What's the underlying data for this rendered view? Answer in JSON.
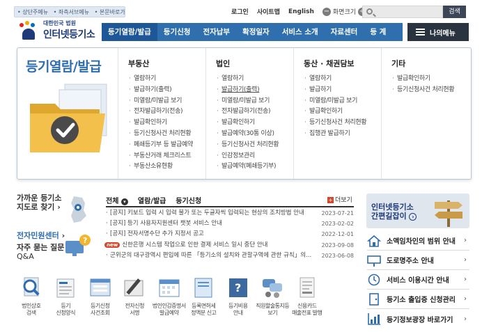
{
  "skip_links": [
    "상단주메뉴",
    "좌측서브메뉴",
    "본문바로가기"
  ],
  "util": {
    "login": "로그인",
    "sitemap": "사이트맵",
    "english": "English",
    "zoom_minus": "−",
    "zoom_label": "화면크기",
    "zoom_plus": "+"
  },
  "search": {
    "placeholder": "",
    "button": "검색"
  },
  "logo": {
    "sub": "대한민국 법원",
    "main": "인터넷등기소"
  },
  "nav": {
    "items": [
      "등기열람/발급",
      "등기신청",
      "전자납부",
      "확정일자",
      "서비스 소개",
      "자료센터",
      "등 계"
    ],
    "my_menu": "나의메뉴"
  },
  "mega": {
    "title": "등기열람/발급",
    "columns": [
      {
        "heading": "부동산",
        "items": [
          "열람하기",
          "발급하기(출력)",
          "미열람/미발급 보기",
          "전자발급하기(전송)",
          "발급확인하기",
          "등기신청사건 처리현황",
          "폐쇄등기부 등 발급예약",
          "부동산거래 체크리스트",
          "부동산소유현황"
        ]
      },
      {
        "heading": "법인",
        "items": [
          "열람하기",
          "발급하기(출력)",
          "미열람/미발급 보기",
          "전자발급하기(전송)",
          "발급확인하기",
          "발급예약(30통 이상)",
          "등기신청사건 처리현황",
          "인감정보관리",
          "발급예약(폐쇄등기부)"
        ]
      },
      {
        "heading": "동산 · 채권담보",
        "items": [
          "열람하기",
          "발급하기",
          "미열람/미발급 보기",
          "발급확인하기",
          "등기신청사건 처리현황",
          "집행관 발급하기"
        ]
      },
      {
        "heading": "기타",
        "items": [
          "발급확인하기",
          "등기신청사건 처리현황"
        ]
      }
    ]
  },
  "quick": {
    "map_title_1": "가까운 등기소",
    "map_title_2": "지도로 찾기",
    "center_title": "전자민원센터",
    "faq_title_1": "자주 묻는 질문",
    "faq_title_2": "Q&A"
  },
  "notice": {
    "tabs": [
      "전체",
      "열람/발급",
      "등기신청"
    ],
    "more": "더보기",
    "items": [
      {
        "text": "[공지] 키보드 입력 시 입력 불가 또는 두글자씩 입력되는 현상의 조치방법 안내",
        "date": "2023-07-21",
        "new": false
      },
      {
        "text": "[공지] 등기 사용자지원센터 챗봇 서비스 안내",
        "date": "2023-02-02",
        "new": false
      },
      {
        "text": "[공지] 전자서명수단 추가 지정서 공고",
        "date": "2022-12-01",
        "new": false
      },
      {
        "text": "신한은행 시스템 작업으로 인한 결제 서비스 일시 중단 안내",
        "date": "2023-09-08",
        "new": true,
        "badge": "new"
      },
      {
        "text": "군위군의 대구광역시 편입에 따른 「등기소의 설치와 관할구역에 관한 규칙」의...",
        "date": "2023-06-08",
        "new": false
      }
    ]
  },
  "icons": [
    {
      "icon": "magnifier-doc-icon",
      "l1": "법인상호",
      "l2": "검색"
    },
    {
      "icon": "form-doc-icon",
      "l1": "등기",
      "l2": "신청양식"
    },
    {
      "icon": "case-search-icon",
      "l1": "등기신청",
      "l2": "사건조회"
    },
    {
      "icon": "signature-pen-icon",
      "l1": "전자신청",
      "l2": "서명"
    },
    {
      "icon": "calendar-icon",
      "l1": "법인인감증명서",
      "l2": "발급예약"
    },
    {
      "icon": "book-icon",
      "l1": "등록면허세",
      "l2": "정액분 신고"
    },
    {
      "icon": "question-book-icon",
      "l1": "등기비용",
      "l2": "안내"
    },
    {
      "icon": "people-talk-icon",
      "l1": "직원할술통지등",
      "l2": "보기"
    },
    {
      "icon": "receipt-icon",
      "l1": "신용카드",
      "l2": "매출전표 발행"
    }
  ],
  "guide": {
    "t1": "인터넷등기소",
    "t2": "간편길잡이"
  },
  "right_list": [
    {
      "icon": "house-icon",
      "label": "소액임차인의 범위 안내"
    },
    {
      "icon": "road-sign-icon",
      "label": "도로명주소 안내"
    },
    {
      "icon": "clock-icon",
      "label": "서비스 이용시간 안내"
    },
    {
      "icon": "door-icon",
      "label": "등기소 출입증 신청관리"
    },
    {
      "icon": "chart-icon",
      "label": "등기정보광장 바로가기"
    }
  ],
  "colors": {
    "nav_blue": "#2f6fae",
    "nav_active": "#1d5797",
    "title_blue": "#2e6db0",
    "dark": "#2a3340",
    "new_red": "#d9452b"
  }
}
